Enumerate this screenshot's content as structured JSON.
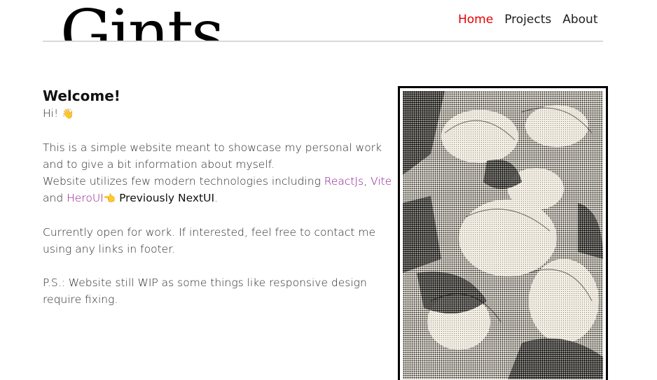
{
  "header": {
    "logo_text": "Gints",
    "nav": [
      {
        "label": "Home",
        "active": true
      },
      {
        "label": "Projects",
        "active": false
      },
      {
        "label": "About",
        "active": false
      }
    ],
    "active_color": "#e10000"
  },
  "main": {
    "title": "Welcome!",
    "greeting": "Hi!",
    "greeting_emoji": "👋",
    "intro": "This is a simple website meant to showcase my personal work and to give a bit information about myself.",
    "tech_prefix": "Website utilizes few modern technologies including ",
    "tech_links": [
      "ReactJs",
      "Vite"
    ],
    "tech_sep": ", ",
    "tech_and": " and",
    "heroui_link": "HeroUI",
    "heroui_emoji": "👈",
    "previously": "Previously NextUI",
    "period": ".",
    "open_for_work": "Currently open for work. If interested, feel free to contact me using any links in footer.",
    "ps": "P.S.: Website still WIP as some things like responsive design require fixing.",
    "link_color": "#8c1a8c"
  },
  "portrait": {
    "icon": "halftone-flower-photo"
  }
}
